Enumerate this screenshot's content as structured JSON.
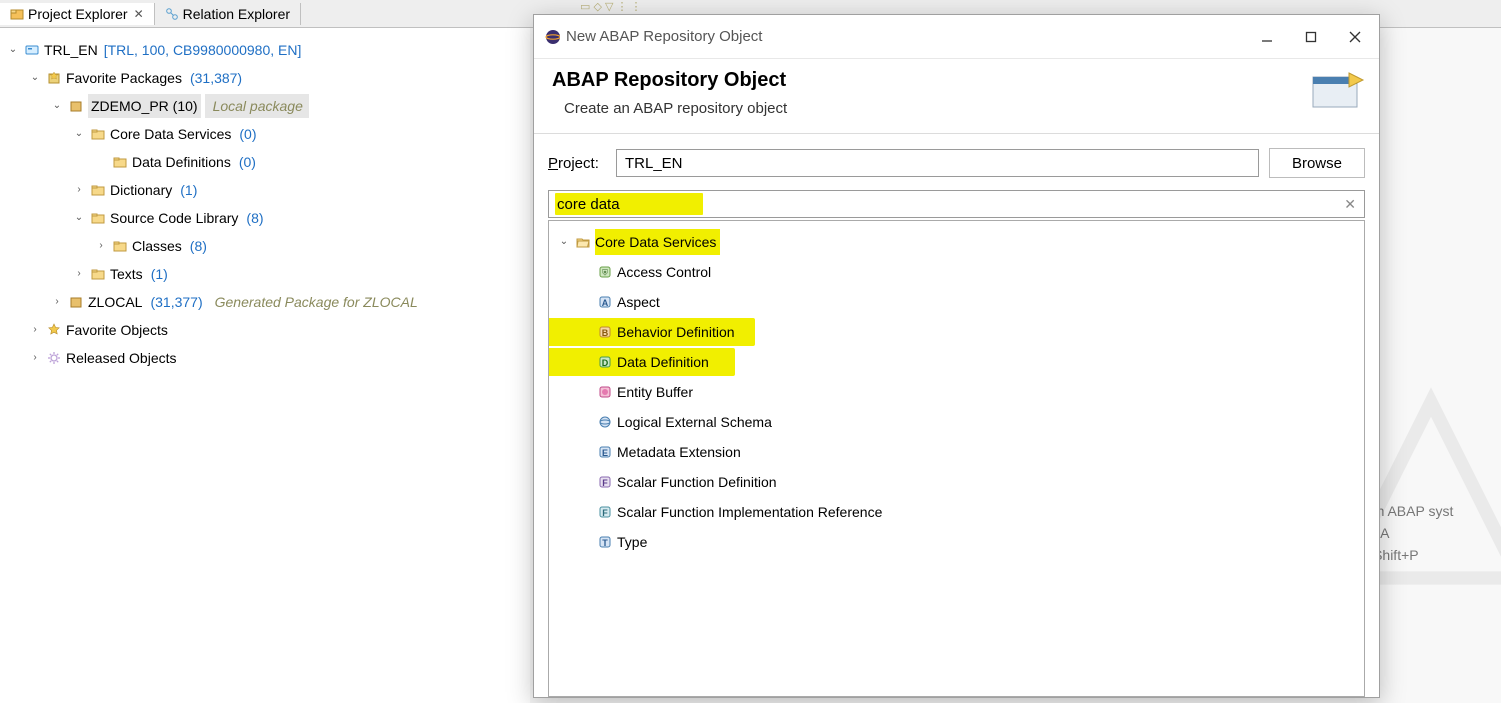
{
  "tabs": {
    "project_explorer": "Project Explorer",
    "relation_explorer": "Relation Explorer"
  },
  "tree": {
    "system_name": "TRL_EN",
    "system_info": "[TRL, 100, CB9980000980, EN]",
    "fav_packages_label": "Favorite Packages",
    "fav_packages_count": "(31,387)",
    "zdemo_label": "ZDEMO_PR (10)",
    "zdemo_desc": "Local package",
    "cds_label": "Core Data Services",
    "cds_count": "(0)",
    "data_def_label": "Data Definitions",
    "data_def_count": "(0)",
    "dict_label": "Dictionary",
    "dict_count": "(1)",
    "scl_label": "Source Code Library",
    "scl_count": "(8)",
    "classes_label": "Classes",
    "classes_count": "(8)",
    "texts_label": "Texts",
    "texts_count": "(1)",
    "zlocal_label": "ZLOCAL",
    "zlocal_count": "(31,377)",
    "zlocal_desc": "Generated Package for ZLOCAL",
    "fav_obj_label": "Favorite Objects",
    "rel_obj_label": "Released Objects"
  },
  "dialog": {
    "window_title": "New ABAP Repository Object",
    "title": "ABAP Repository Object",
    "subtitle": "Create an ABAP repository object",
    "project_label": "Project:",
    "project_value": "TRL_EN",
    "browse_label": "Browse",
    "filter_value": "core data",
    "category": "Core Data Services",
    "items": [
      "Access Control",
      "Aspect",
      "Behavior Definition",
      "Data Definition",
      "Entity Buffer",
      "Logical External Schema",
      "Metadata Extension",
      "Scalar Function Definition",
      "Scalar Function Implementation Reference",
      "Type"
    ]
  },
  "hint": {
    "l1": "t an ABAP syst",
    "l2": "ift+A",
    "l3": "t+Shift+P"
  }
}
